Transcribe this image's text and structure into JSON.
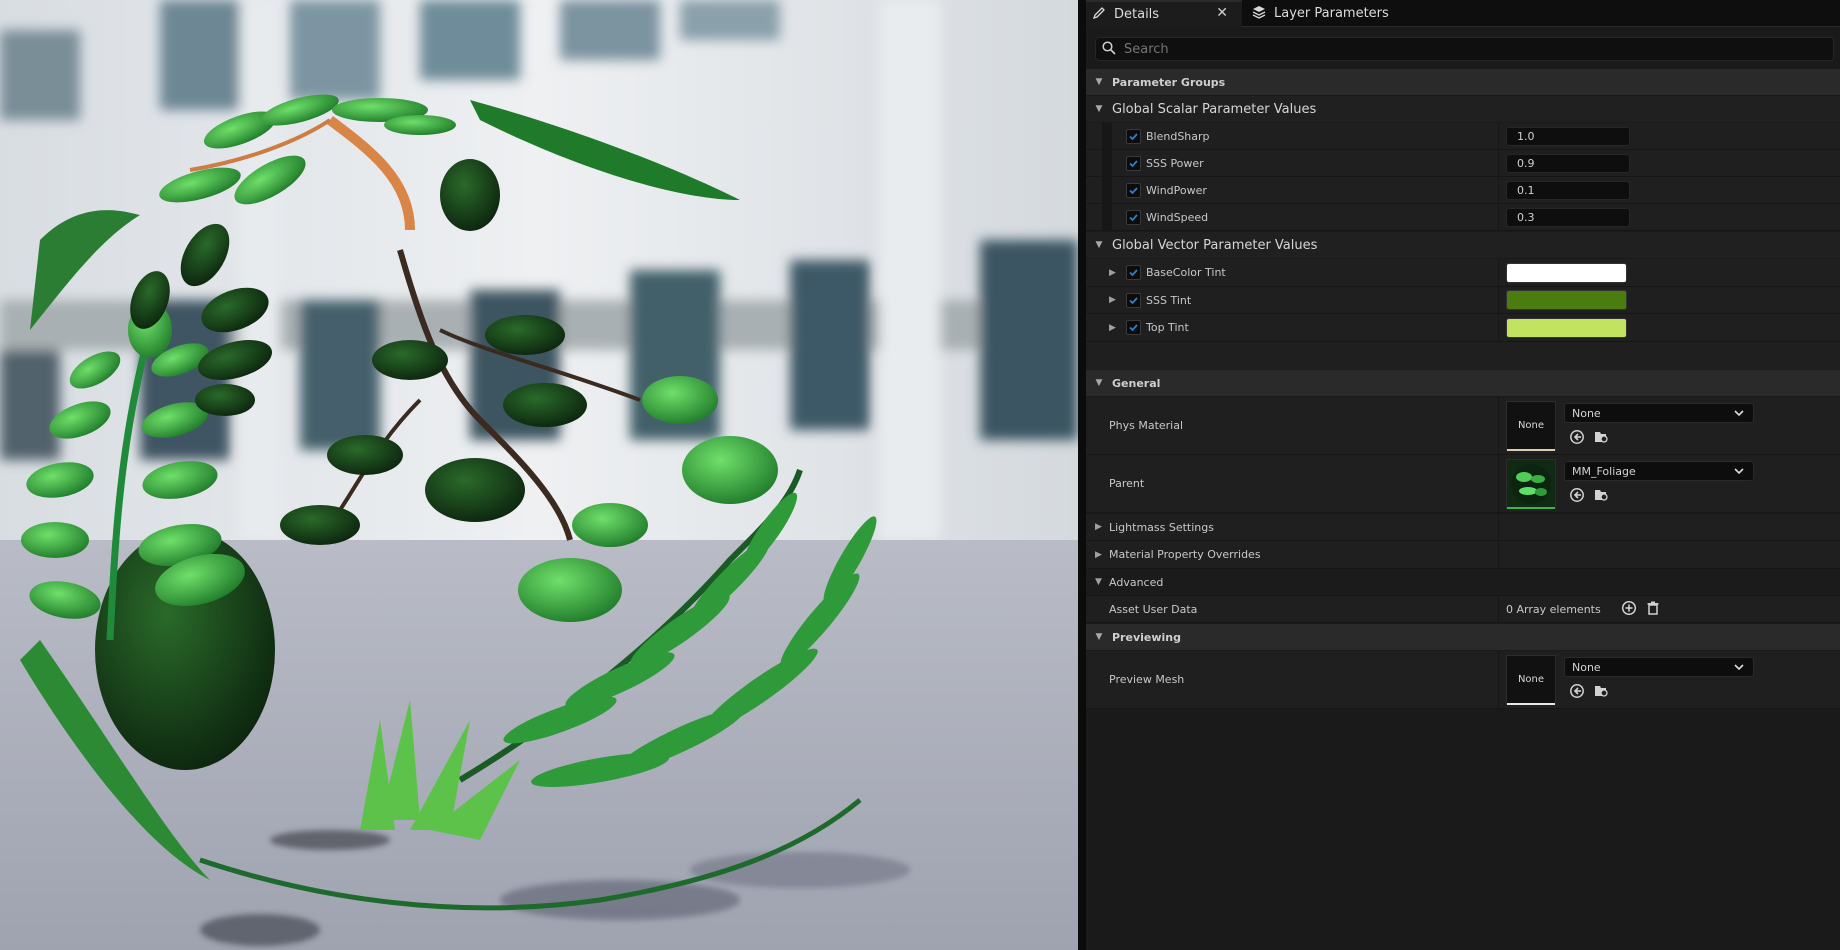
{
  "tabs": {
    "details": "Details",
    "layer_parameters": "Layer Parameters"
  },
  "search": {
    "placeholder": "Search"
  },
  "parameter_groups": {
    "title": "Parameter Groups",
    "scalar_group": {
      "title": "Global Scalar Parameter Values",
      "items": [
        {
          "name": "BlendSharp",
          "value": "1.0"
        },
        {
          "name": "SSS Power",
          "value": "0.9"
        },
        {
          "name": "WindPower",
          "value": "0.1"
        },
        {
          "name": "WindSpeed",
          "value": "0.3"
        }
      ]
    },
    "vector_group": {
      "title": "Global Vector Parameter Values",
      "items": [
        {
          "name": "BaseColor Tint",
          "color": "#ffffff"
        },
        {
          "name": "SSS Tint",
          "color": "#4a7c0f"
        },
        {
          "name": "Top Tint",
          "color": "#c2e35f"
        }
      ]
    }
  },
  "general": {
    "title": "General",
    "phys_material": {
      "label": "Phys Material",
      "thumb_text": "None",
      "value": "None"
    },
    "parent": {
      "label": "Parent",
      "value": "MM_Foliage"
    },
    "lightmass": "Lightmass Settings",
    "overrides": "Material Property Overrides",
    "advanced": "Advanced",
    "asset_user_data": {
      "label": "Asset User Data",
      "value": "0 Array elements"
    }
  },
  "previewing": {
    "title": "Previewing",
    "preview_mesh": {
      "label": "Preview Mesh",
      "thumb_text": "None",
      "value": "None"
    }
  },
  "colors": {
    "accent": "#2f7fd0",
    "panel_bg": "#1a1a1a"
  }
}
